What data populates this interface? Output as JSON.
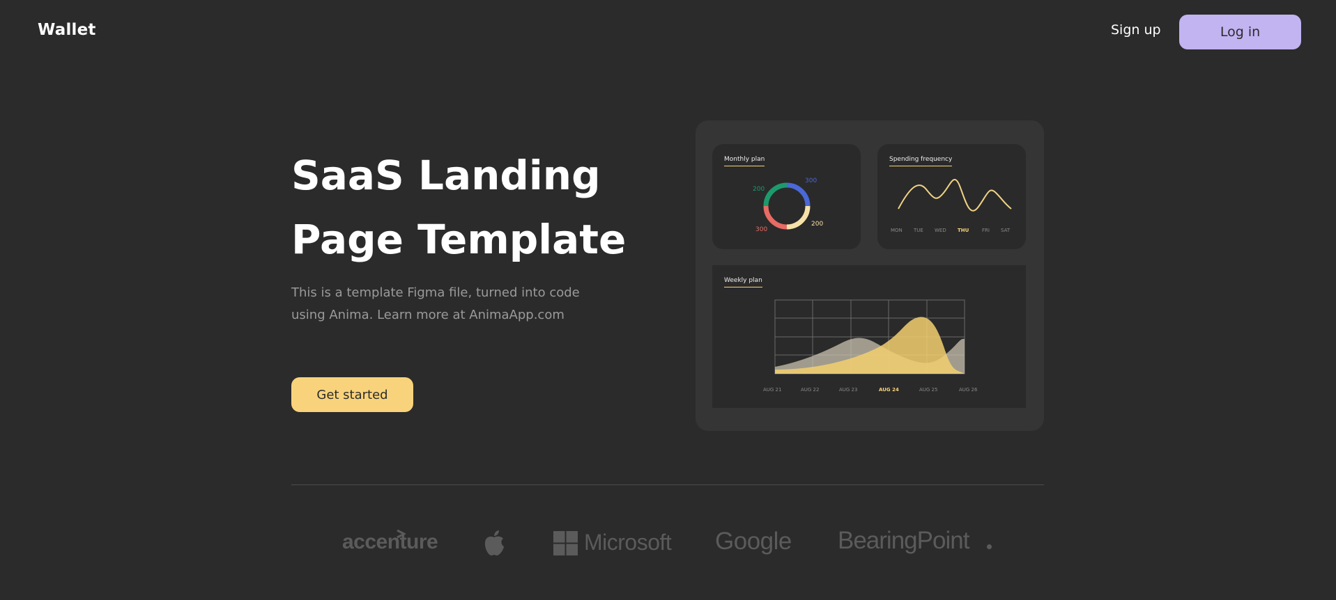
{
  "header": {
    "brand": "Wallet",
    "signup_label": "Sign up",
    "login_label": "Log in"
  },
  "hero": {
    "title_line1": "SaaS Landing",
    "title_line2": "Page Template",
    "subtitle_line1": "This is a template Figma file, turned into code",
    "subtitle_line2": "using Anima. Learn more at AnimaApp.com",
    "cta_label": "Get started"
  },
  "dashboard": {
    "monthly_plan": {
      "title": "Monthly plan",
      "labels": [
        "300",
        "200",
        "300",
        "200"
      ]
    },
    "spending_frequency": {
      "title": "Spending frequency",
      "days": [
        "MON",
        "TUE",
        "WED",
        "THU",
        "FRI",
        "SAT"
      ],
      "active_day": "THU"
    },
    "weekly_plan": {
      "title": "Weekly plan",
      "dates": [
        "AUG 21",
        "AUG 22",
        "AUG 23",
        "AUG 24",
        "AUG 25",
        "AUG 26"
      ],
      "active_date": "AUG 24"
    }
  },
  "logos": {
    "accenture": "accenture",
    "apple": "apple-logo",
    "microsoft": "Microsoft",
    "google": "Google",
    "bearingpoint": "BearingPoint"
  },
  "colors": {
    "background": "#2b2b2b",
    "accent_purple": "#c2b3f1",
    "accent_yellow": "#f9d37b",
    "logo_gray": "#5b5b5b"
  }
}
